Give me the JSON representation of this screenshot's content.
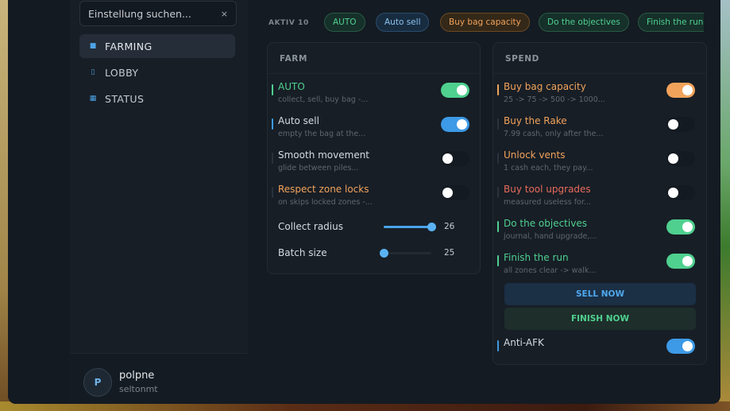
{
  "colors": {
    "green": "#4fd08f",
    "blue": "#3d9ae6",
    "orange": "#f2a35b",
    "red": "#e86b5a",
    "white": "#d7dbe0"
  },
  "search": {
    "placeholder": "Einstellung suchen...",
    "clear_icon": "×"
  },
  "sidebar": {
    "items": [
      {
        "label": "FARMING",
        "icon": "■",
        "icon_name": "farming-icon",
        "active": true
      },
      {
        "label": "LOBBY",
        "icon": "▯",
        "icon_name": "lobby-icon",
        "active": false
      },
      {
        "label": "STATUS",
        "icon": "▦",
        "icon_name": "status-icon",
        "active": false
      }
    ]
  },
  "profile": {
    "initial": "P",
    "name": "polpne",
    "sub": "seltonmt"
  },
  "topbar": {
    "active_label": "AKTIV 10",
    "chips": [
      {
        "label": "AUTO",
        "color": "green"
      },
      {
        "label": "Auto sell",
        "color": "blue"
      },
      {
        "label": "Buy bag capacity",
        "color": "orange"
      },
      {
        "label": "Do the objectives",
        "color": "green"
      },
      {
        "label": "Finish the run",
        "color": "green"
      }
    ]
  },
  "farm": {
    "title": "FARM",
    "rows": [
      {
        "title": "AUTO",
        "desc": "collect, sell, buy bag -...",
        "color": "green",
        "bar": "green",
        "on": true
      },
      {
        "title": "Auto sell",
        "desc": "empty the bag at the...",
        "color": "white",
        "bar": "blue",
        "on": true
      },
      {
        "title": "Smooth movement",
        "desc": "glide between piles...",
        "color": "white",
        "bar": "none",
        "on": false
      },
      {
        "title": "Respect zone locks",
        "desc": "on skips locked zones -...",
        "color": "orange",
        "bar": "none",
        "on": false
      }
    ],
    "sliders": [
      {
        "label": "Collect radius",
        "value": "26",
        "fraction": 1.0
      },
      {
        "label": "Batch size",
        "value": "25",
        "fraction": 0.0
      }
    ]
  },
  "spend": {
    "title": "SPEND",
    "rows": [
      {
        "title": "Buy bag capacity",
        "desc": "25 -> 75 -> 500 -> 1000...",
        "color": "orange",
        "bar": "orange",
        "on": true
      },
      {
        "title": "Buy the Rake",
        "desc": "7.99 cash, only after the...",
        "color": "orange",
        "bar": "none",
        "on": false
      },
      {
        "title": "Unlock vents",
        "desc": "1 cash each, they pay...",
        "color": "orange",
        "bar": "none",
        "on": false
      },
      {
        "title": "Buy tool upgrades",
        "desc": "measured useless for...",
        "color": "red",
        "bar": "none",
        "on": false
      },
      {
        "title": "Do the objectives",
        "desc": "journal, hand upgrade,...",
        "color": "green",
        "bar": "green",
        "on": true
      },
      {
        "title": "Finish the run",
        "desc": "all zones clear -> walk...",
        "color": "green",
        "bar": "green",
        "on": true
      }
    ],
    "sell_now": "SELL NOW",
    "finish_now": "FINISH NOW",
    "anti_afk": {
      "title": "Anti-AFK",
      "color": "white",
      "bar": "blue",
      "on": true
    }
  }
}
